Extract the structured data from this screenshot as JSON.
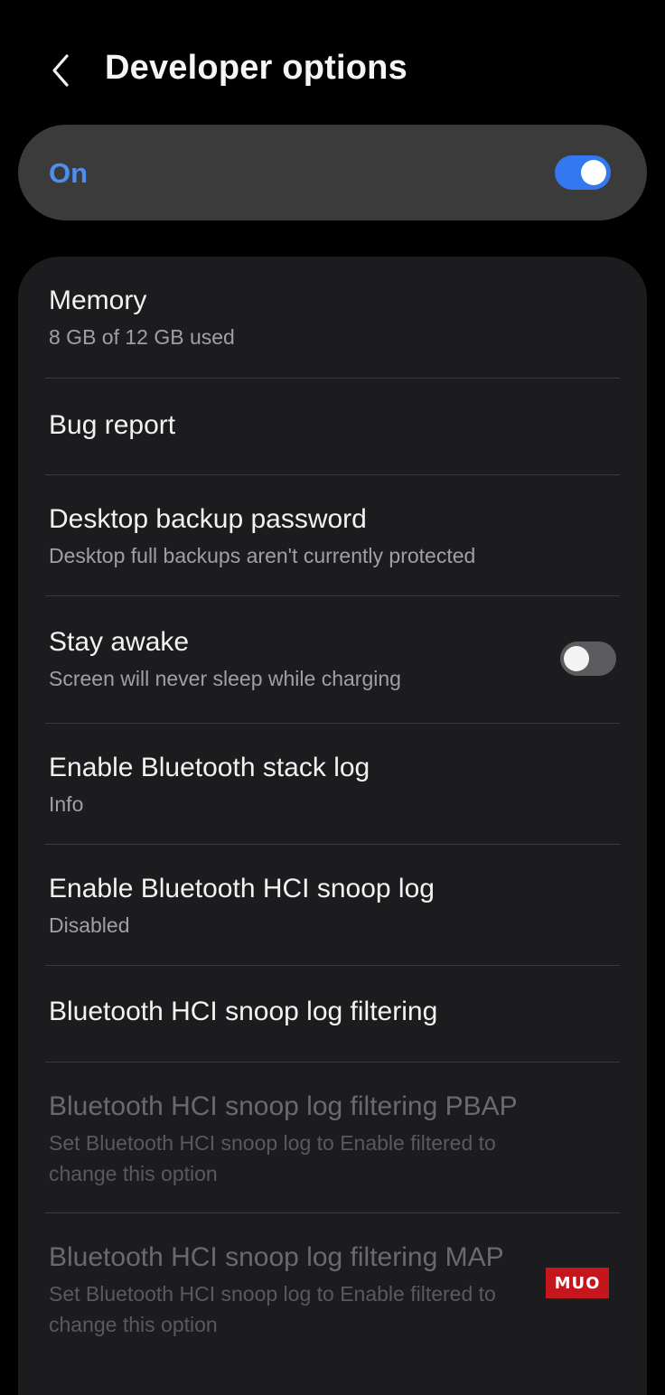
{
  "header": {
    "title": "Developer options",
    "back_icon": "chevron-left-icon"
  },
  "master_switch": {
    "label": "On",
    "state": true,
    "accent_color": "#3478f0"
  },
  "items": [
    {
      "title": "Memory",
      "subtitle": "8 GB of 12 GB used"
    },
    {
      "title": "Bug report"
    },
    {
      "title": "Desktop backup password",
      "subtitle": "Desktop full backups aren't currently protected"
    },
    {
      "title": "Stay awake",
      "subtitle": "Screen will never sleep while charging",
      "toggle": false
    },
    {
      "title": "Enable Bluetooth stack log",
      "subtitle": "Info"
    },
    {
      "title": "Enable Bluetooth HCI snoop log",
      "subtitle": "Disabled"
    },
    {
      "title": "Bluetooth HCI snoop log filtering"
    },
    {
      "title": "Bluetooth HCI snoop log filtering PBAP",
      "subtitle": "Set Bluetooth HCI snoop log to Enable filtered to change this option",
      "disabled": true
    },
    {
      "title": "Bluetooth HCI snoop log filtering MAP",
      "subtitle": "Set Bluetooth HCI snoop log to Enable filtered to change this option",
      "disabled": true
    }
  ],
  "watermark": {
    "text": "MUO",
    "color": "#c4161c"
  }
}
